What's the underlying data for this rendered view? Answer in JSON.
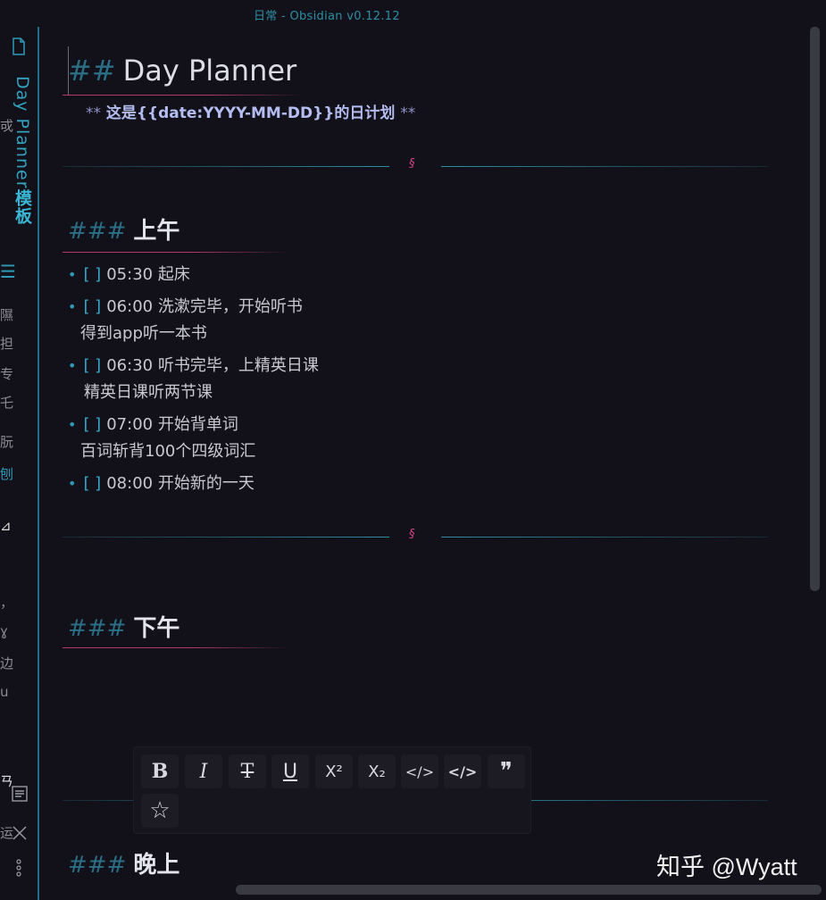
{
  "window": {
    "title": "日常 - Obsidian v0.12.12"
  },
  "sidebar": {
    "vertical_title_latin": "Day Planner",
    "vertical_title_cjk": "模板",
    "fragments": [
      "戓",
      "隰",
      "担",
      "专",
      "乇",
      "朊",
      "刨",
      "，",
      "ɣ",
      "边",
      "u",
      "ㄢ",
      "运"
    ]
  },
  "document": {
    "heading2": {
      "hashes": "##",
      "text": "Day Planner"
    },
    "subtitle": {
      "open_stars": "**",
      "text": "这是{{date:YYYY-MM-DD}}的日计划",
      "close_stars": "**"
    },
    "separator_symbol": "§",
    "sections": [
      {
        "hashes": "###",
        "title": "上午",
        "tasks": [
          {
            "checkbox": "[ ]",
            "text": "05:30 起床",
            "note": ""
          },
          {
            "checkbox": "[ ]",
            "text": "06:00 洗漱完毕，开始听书",
            "note": "得到app听一本书"
          },
          {
            "checkbox": "[ ]",
            "text": "06:30 听书完毕，上精英日课",
            "note": "精英日课听两节课"
          },
          {
            "checkbox": "[ ]",
            "text": "07:00 开始背单词",
            "note": "百词斩背100个四级词汇"
          },
          {
            "checkbox": "[ ]",
            "text": "08:00 开始新的一天",
            "note": ""
          }
        ]
      },
      {
        "hashes": "###",
        "title": "下午"
      },
      {
        "hashes": "###",
        "title": "晚上"
      }
    ]
  },
  "format_toolbar": {
    "buttons": [
      {
        "name": "bold",
        "glyph": "B"
      },
      {
        "name": "italic",
        "glyph": "I"
      },
      {
        "name": "strikethrough",
        "glyph": "T"
      },
      {
        "name": "underline",
        "glyph": "U"
      },
      {
        "name": "superscript",
        "glyph": "X²"
      },
      {
        "name": "subscript",
        "glyph": "X₂"
      },
      {
        "name": "inline-code",
        "glyph": "</>"
      },
      {
        "name": "code-block",
        "glyph": "</>"
      },
      {
        "name": "blockquote",
        "glyph": "❞"
      },
      {
        "name": "star",
        "glyph": "☆"
      }
    ]
  },
  "watermark": "知乎 @Wyatt",
  "colors": {
    "background": "#121019",
    "accent": "#2d8fa5",
    "heading_underline": "#b73a6e",
    "separator_symbol": "#d6468a"
  }
}
